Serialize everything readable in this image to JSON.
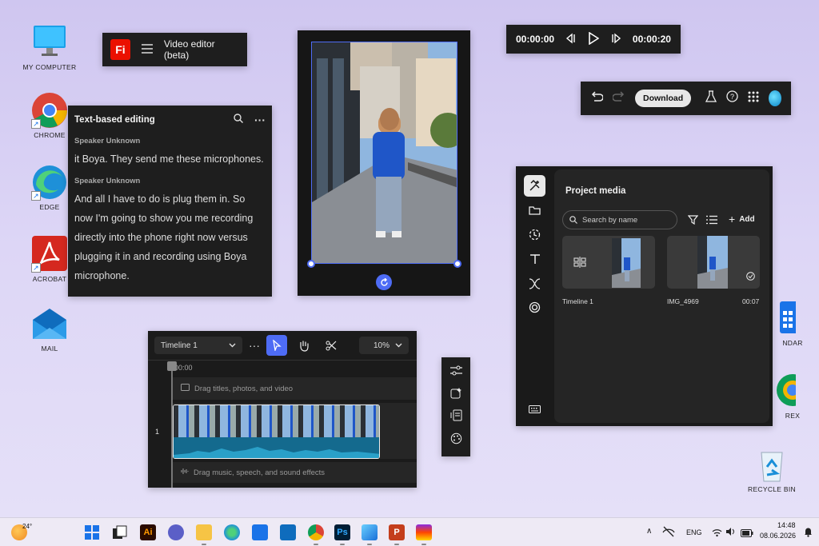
{
  "desktop": {
    "icons": [
      {
        "label": "MY COMPUTER"
      },
      {
        "label": "CHROME"
      },
      {
        "label": "EDGE"
      },
      {
        "label": "ACROBAT"
      },
      {
        "label": "MAIL"
      },
      {
        "label": "NDAR"
      },
      {
        "label": "REX"
      },
      {
        "label": "RECYCLE BIN"
      }
    ]
  },
  "appbar": {
    "logo": "Fi",
    "title": "Video editor (beta)",
    "menu_icon": "hamburger-icon"
  },
  "text_panel": {
    "title": "Text-based editing",
    "blocks": [
      {
        "speaker": "Speaker Unknown",
        "text": "it Boya. They send me these microphones."
      },
      {
        "speaker": "Speaker Unknown",
        "text": "And all I have to do is plug them in. So now I'm going to show you me recording directly into the phone right now versus plugging it in and recording using Boya microphone."
      }
    ]
  },
  "transport": {
    "current": "00:00:00",
    "total": "00:00:20"
  },
  "toolbar": {
    "download_label": "Download"
  },
  "media": {
    "title": "Project media",
    "search_placeholder": "Search by name",
    "add_label": "Add",
    "items": [
      {
        "name": "Timeline 1",
        "duration": ""
      },
      {
        "name": "IMG_4969",
        "duration": "00:07"
      }
    ]
  },
  "timeline": {
    "name": "Timeline 1",
    "zoom": "10%",
    "ruler_start": "00:00",
    "title_track_hint": "Drag titles, photos, and video",
    "track_number": "1",
    "audio_track_hint": "Drag music, speech, and sound effects"
  },
  "taskbar": {
    "weather": "24°",
    "lang": "ENG",
    "time": "14:48",
    "date": "08.06.2026"
  },
  "colors": {
    "accent": "#4e6cf5",
    "brand": "#eb1000",
    "panel": "#1e1e1e"
  }
}
